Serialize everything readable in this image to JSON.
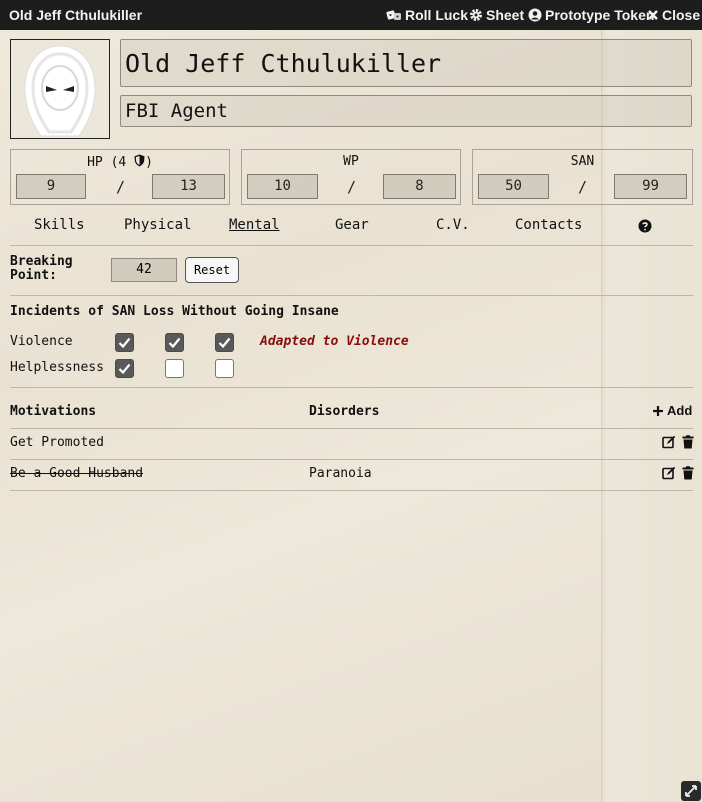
{
  "window": {
    "title": "Old Jeff Cthulukiller",
    "actions": {
      "roll_luck": "Roll Luck",
      "sheet": "Sheet",
      "prototype_token": "Prototype Token",
      "close": "Close"
    }
  },
  "character": {
    "name": "Old Jeff Cthulukiller",
    "occupation": "FBI Agent"
  },
  "stats": {
    "hp": {
      "label": "HP (4",
      "current": "9",
      "max": "13"
    },
    "wp": {
      "label": "WP",
      "current": "10",
      "max": "8"
    },
    "san": {
      "label": "SAN",
      "current": "50",
      "max": "99"
    },
    "separator": "/"
  },
  "tabs": [
    "Skills",
    "Physical",
    "Mental",
    "Gear",
    "C.V.",
    "Contacts"
  ],
  "active_tab": "Mental",
  "mental": {
    "breaking_point_label_1": "Breaking",
    "breaking_point_label_2": "Point:",
    "breaking_point_value": "42",
    "reset_label": "Reset",
    "incidents_title": "Incidents of SAN Loss Without Going Insane",
    "violence_label": "Violence",
    "violence_checks": [
      true,
      true,
      true
    ],
    "adapted_text": "Adapted to Violence",
    "helplessness_label": "Helplessness",
    "helplessness_checks": [
      true,
      false,
      false
    ],
    "motivations_header": "Motivations",
    "disorders_header": "Disorders",
    "add_label": "Add",
    "rows": [
      {
        "motivation": "Get Promoted",
        "disorder": "",
        "struck": false
      },
      {
        "motivation": "Be a Good Husband",
        "disorder": "Paranoia",
        "struck": true
      }
    ]
  },
  "colors": {
    "titlebar": "#1d1d1d",
    "paper": "#efe9dc",
    "adapted_red": "#8b0c0c",
    "checkbox_on": "#595959"
  },
  "icons": [
    "dice-icon",
    "gear-icon",
    "user-circle-icon",
    "close-icon",
    "shield-icon",
    "help-icon",
    "plus-icon",
    "edit-icon",
    "trash-icon",
    "hooded-figure-icon",
    "resize-icon"
  ]
}
